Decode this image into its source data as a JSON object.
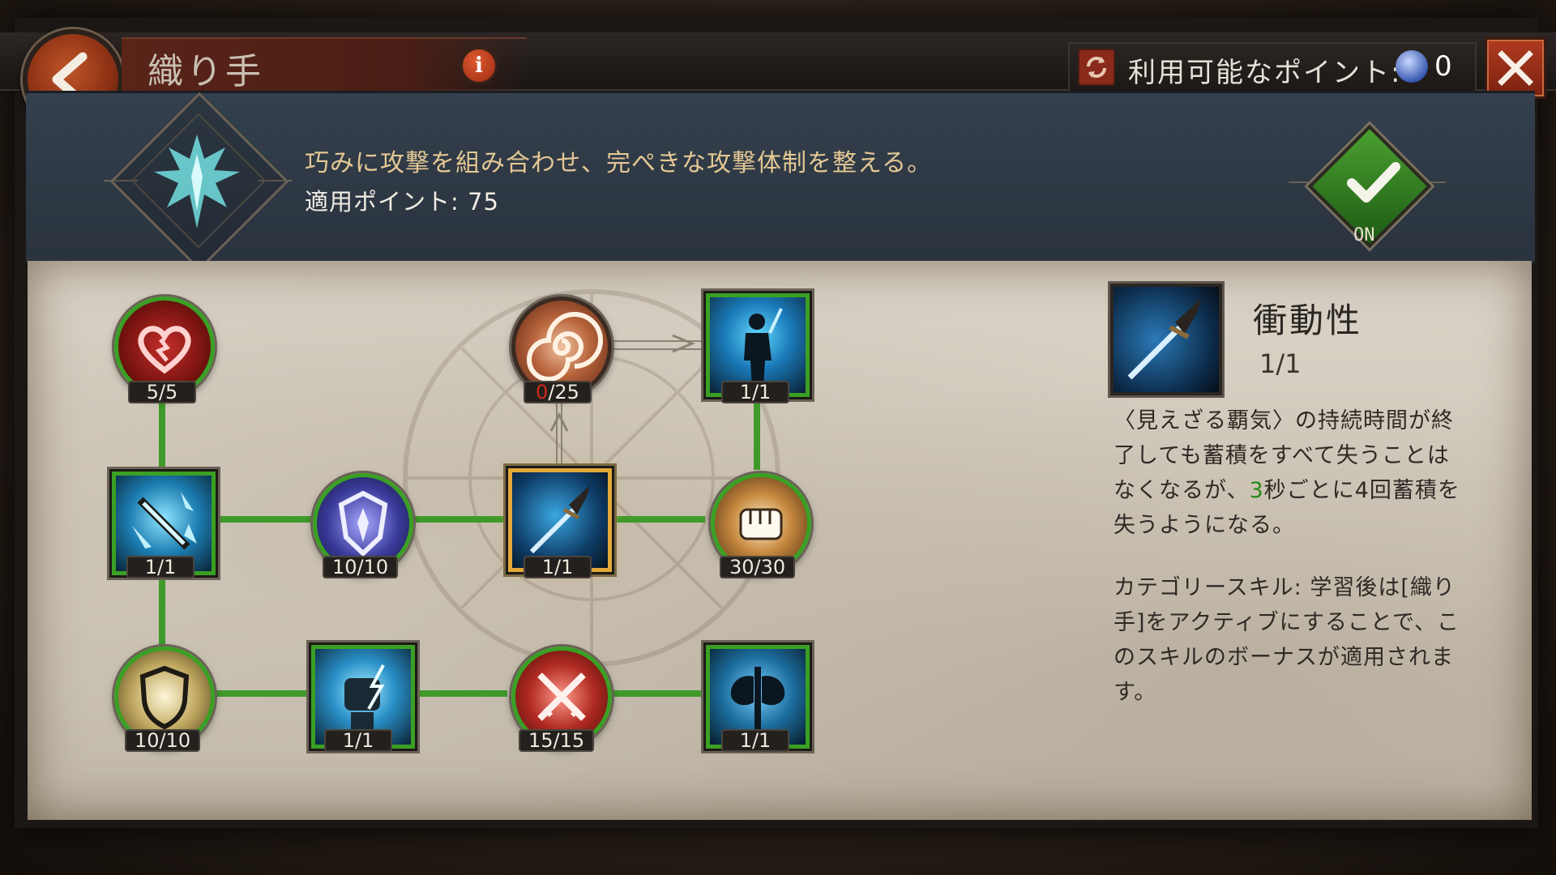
{
  "window": {
    "title": "織り手"
  },
  "points": {
    "label": "利用可能なポイント:",
    "value": "0"
  },
  "header": {
    "description": "巧みに攻撃を組み合わせ、完ぺきな攻撃体制を整える。",
    "applied_points": "適用ポイント: 75",
    "toggle_label": "ON"
  },
  "tree": {
    "nodes": [
      {
        "id": "heart",
        "level": "5/5",
        "shape": "circle",
        "icon": "heart-icon"
      },
      {
        "id": "vortex",
        "level_current": "0",
        "level_max": "/25",
        "shape": "circle",
        "icon": "vortex-icon"
      },
      {
        "id": "warrior",
        "level": "1/1",
        "shape": "square",
        "icon": "warrior-icon"
      },
      {
        "id": "ice-blade",
        "level": "1/1",
        "shape": "square",
        "icon": "ice-blade-icon"
      },
      {
        "id": "blue-shield",
        "level": "10/10",
        "shape": "circle",
        "icon": "emblem-shield-icon"
      },
      {
        "id": "impulse",
        "level": "1/1",
        "shape": "square",
        "icon": "dagger-icon"
      },
      {
        "id": "fist",
        "level": "30/30",
        "shape": "circle",
        "icon": "fist-icon"
      },
      {
        "id": "white-shield",
        "level": "10/10",
        "shape": "circle",
        "icon": "shield-icon"
      },
      {
        "id": "lightning-fist",
        "level": "1/1",
        "shape": "square",
        "icon": "lightning-fist-icon"
      },
      {
        "id": "crossed-swords",
        "level": "15/15",
        "shape": "circle",
        "icon": "crossed-swords-icon"
      },
      {
        "id": "axe",
        "level": "1/1",
        "shape": "square",
        "icon": "axe-icon"
      }
    ]
  },
  "detail": {
    "name": "衝動性",
    "level": "1/1",
    "desc_1": "〈見えざる覇気〉の持続時間が終了しても蓄積をすべて失うことはなくなるが、",
    "desc_highlight": "3",
    "desc_2": "秒ごとに4回蓄積を失うようになる。",
    "category": "カテゴリースキル: 学習後は[織り手]をアクティブにすることで、このスキルのボーナスが適用されます。"
  },
  "colors": {
    "active_link": "#3f9a2a",
    "selected_border": "#e2a83a",
    "highlight_number": "#2a8a18",
    "locked_count": "#d02a1a"
  }
}
